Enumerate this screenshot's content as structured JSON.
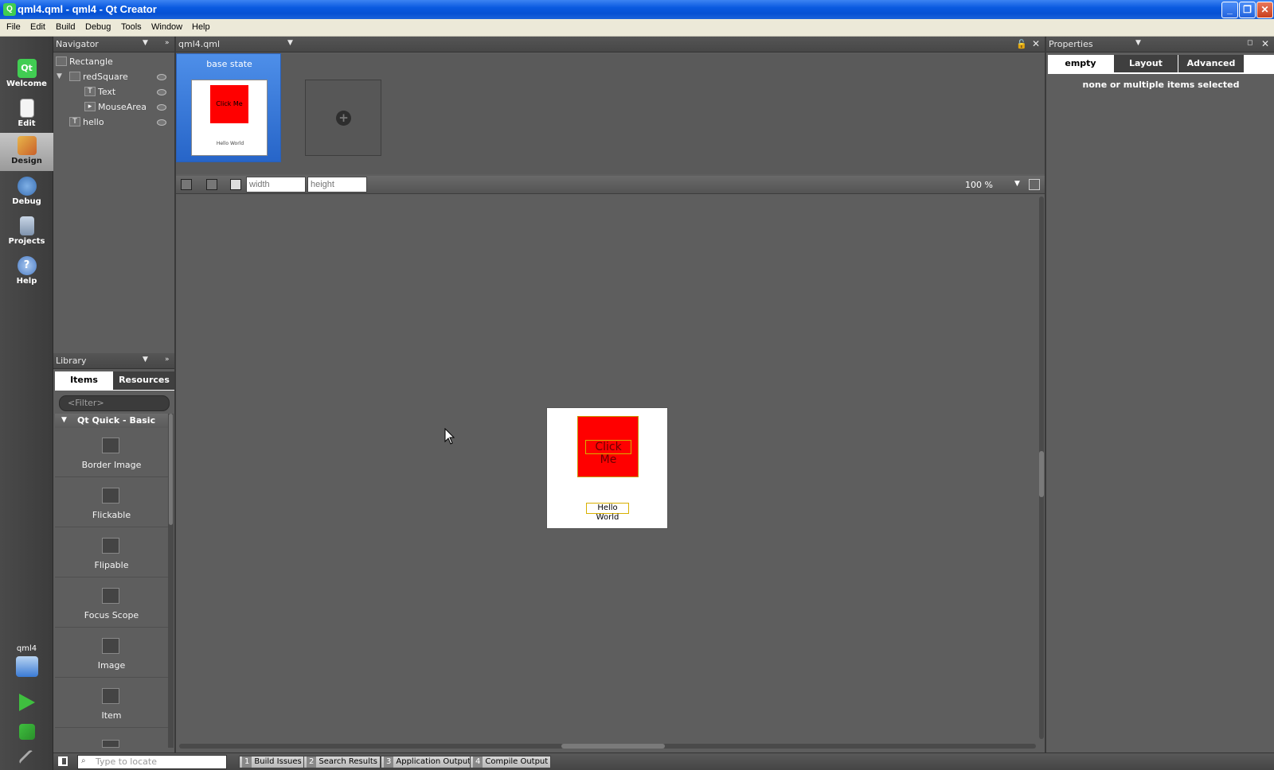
{
  "window": {
    "title": "qml4.qml - qml4 - Qt Creator",
    "controls": [
      "_",
      "❐",
      "✕"
    ]
  },
  "menu": [
    "File",
    "Edit",
    "Build",
    "Debug",
    "Tools",
    "Window",
    "Help"
  ],
  "modes": [
    {
      "label": "Welcome",
      "icon": "qt-logo-icon"
    },
    {
      "label": "Edit",
      "icon": "edit-document-icon"
    },
    {
      "label": "Design",
      "icon": "design-pencil-icon",
      "active": true
    },
    {
      "label": "Debug",
      "icon": "debug-bug-icon"
    },
    {
      "label": "Projects",
      "icon": "projects-book-icon"
    },
    {
      "label": "Help",
      "icon": "help-question-icon"
    }
  ],
  "kit": {
    "label": "qml4",
    "icon": "computer-icon"
  },
  "navigator": {
    "title": "Navigator",
    "items": [
      {
        "name": "Rectangle",
        "level": 0,
        "icon": "rectangle-icon"
      },
      {
        "name": "redSquare",
        "level": 0,
        "icon": "rectangle-icon",
        "expanded": true
      },
      {
        "name": "Text",
        "level": 1,
        "icon": "text-icon"
      },
      {
        "name": "MouseArea",
        "level": 1,
        "icon": "mousearea-icon"
      },
      {
        "name": "hello",
        "level": 0,
        "icon": "text-icon"
      }
    ]
  },
  "editor": {
    "file": "qml4.qml",
    "states": {
      "base_label": "base state",
      "thumb_button": "Click Me",
      "thumb_text": "Hello World"
    },
    "toolbar": {
      "width_placeholder": "width",
      "height_placeholder": "height",
      "zoom": "100 %"
    },
    "canvas": {
      "button_text": "Click Me",
      "hello_text": "Hello World"
    }
  },
  "library": {
    "title": "Library",
    "tabs": [
      "Items",
      "Resources"
    ],
    "filter_placeholder": "<Filter>",
    "category": "Qt Quick - Basic",
    "items": [
      "Border Image",
      "Flickable",
      "Flipable",
      "Focus Scope",
      "Image",
      "Item"
    ]
  },
  "properties": {
    "title": "Properties",
    "tabs": [
      "empty",
      "Layout",
      "Advanced"
    ],
    "message": "none or multiple items selected"
  },
  "statusbar": {
    "locate_placeholder": "Type to locate",
    "outputs": [
      {
        "num": "1",
        "label": "Build Issues"
      },
      {
        "num": "2",
        "label": "Search Results"
      },
      {
        "num": "3",
        "label": "Application Output"
      },
      {
        "num": "4",
        "label": "Compile Output"
      }
    ]
  },
  "colors": {
    "accent": "#2765c8",
    "red_square": "#ff0000",
    "panel": "#5e5e5e"
  }
}
